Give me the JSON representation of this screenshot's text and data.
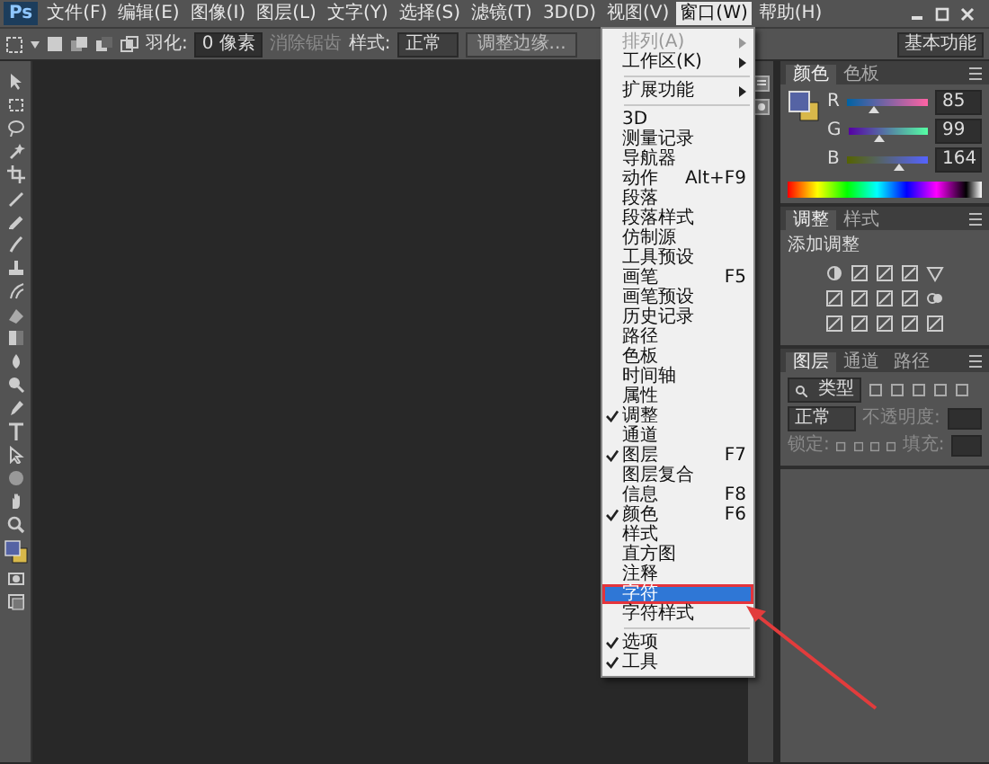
{
  "app_logo": "Ps",
  "menu_bar": [
    {
      "label": "文件(F)",
      "selected": false
    },
    {
      "label": "编辑(E)",
      "selected": false
    },
    {
      "label": "图像(I)",
      "selected": false
    },
    {
      "label": "图层(L)",
      "selected": false
    },
    {
      "label": "文字(Y)",
      "selected": false
    },
    {
      "label": "选择(S)",
      "selected": false
    },
    {
      "label": "滤镜(T)",
      "selected": false
    },
    {
      "label": "3D(D)",
      "selected": false
    },
    {
      "label": "视图(V)",
      "selected": false
    },
    {
      "label": "窗口(W)",
      "selected": true
    },
    {
      "label": "帮助(H)",
      "selected": false
    }
  ],
  "options_bar": {
    "feather_label": "羽化:",
    "feather_value": "0 像素",
    "anti_alias": {
      "label": "消除锯齿",
      "disabled": true
    },
    "style_label": "样式:",
    "style_value": "正常",
    "refine_edge": "调整边缘...",
    "workspace": "基本功能"
  },
  "window_menu": [
    {
      "kind": "item",
      "label": "排列(A)",
      "submenu": true,
      "disabled": true,
      "checked": false,
      "selected": false
    },
    {
      "kind": "item",
      "label": "工作区(K)",
      "submenu": true,
      "disabled": false,
      "checked": false,
      "selected": false
    },
    {
      "kind": "separator"
    },
    {
      "kind": "item",
      "label": "扩展功能",
      "submenu": true,
      "disabled": false,
      "checked": false,
      "selected": false
    },
    {
      "kind": "separator"
    },
    {
      "kind": "item",
      "label": "3D",
      "disabled": false,
      "checked": false,
      "selected": false
    },
    {
      "kind": "item",
      "label": "测量记录",
      "disabled": false,
      "checked": false,
      "selected": false
    },
    {
      "kind": "item",
      "label": "导航器",
      "disabled": false,
      "checked": false,
      "selected": false
    },
    {
      "kind": "item",
      "label": "动作",
      "shortcut": "Alt+F9",
      "disabled": false,
      "checked": false,
      "selected": false
    },
    {
      "kind": "item",
      "label": "段落",
      "disabled": false,
      "checked": false,
      "selected": false
    },
    {
      "kind": "item",
      "label": "段落样式",
      "disabled": false,
      "checked": false,
      "selected": false
    },
    {
      "kind": "item",
      "label": "仿制源",
      "disabled": false,
      "checked": false,
      "selected": false
    },
    {
      "kind": "item",
      "label": "工具预设",
      "disabled": false,
      "checked": false,
      "selected": false
    },
    {
      "kind": "item",
      "label": "画笔",
      "shortcut": "F5",
      "disabled": false,
      "checked": false,
      "selected": false
    },
    {
      "kind": "item",
      "label": "画笔预设",
      "disabled": false,
      "checked": false,
      "selected": false
    },
    {
      "kind": "item",
      "label": "历史记录",
      "disabled": false,
      "checked": false,
      "selected": false
    },
    {
      "kind": "item",
      "label": "路径",
      "disabled": false,
      "checked": false,
      "selected": false
    },
    {
      "kind": "item",
      "label": "色板",
      "disabled": false,
      "checked": false,
      "selected": false
    },
    {
      "kind": "item",
      "label": "时间轴",
      "disabled": false,
      "checked": false,
      "selected": false
    },
    {
      "kind": "item",
      "label": "属性",
      "disabled": false,
      "checked": false,
      "selected": false
    },
    {
      "kind": "item",
      "label": "调整",
      "disabled": false,
      "checked": true,
      "selected": false
    },
    {
      "kind": "item",
      "label": "通道",
      "disabled": false,
      "checked": false,
      "selected": false
    },
    {
      "kind": "item",
      "label": "图层",
      "shortcut": "F7",
      "disabled": false,
      "checked": true,
      "selected": false
    },
    {
      "kind": "item",
      "label": "图层复合",
      "disabled": false,
      "checked": false,
      "selected": false
    },
    {
      "kind": "item",
      "label": "信息",
      "shortcut": "F8",
      "disabled": false,
      "checked": false,
      "selected": false
    },
    {
      "kind": "item",
      "label": "颜色",
      "shortcut": "F6",
      "disabled": false,
      "checked": true,
      "selected": false
    },
    {
      "kind": "item",
      "label": "样式",
      "disabled": false,
      "checked": false,
      "selected": false
    },
    {
      "kind": "item",
      "label": "直方图",
      "disabled": false,
      "checked": false,
      "selected": false
    },
    {
      "kind": "item",
      "label": "注释",
      "disabled": false,
      "checked": false,
      "selected": false
    },
    {
      "kind": "item",
      "label": "字符",
      "disabled": false,
      "checked": false,
      "selected": true
    },
    {
      "kind": "item",
      "label": "字符样式",
      "disabled": false,
      "checked": false,
      "selected": false
    },
    {
      "kind": "separator"
    },
    {
      "kind": "item",
      "label": "选项",
      "disabled": false,
      "checked": true,
      "selected": false
    },
    {
      "kind": "item",
      "label": "工具",
      "disabled": false,
      "checked": true,
      "selected": false
    }
  ],
  "color_panel": {
    "tabs": [
      {
        "label": "颜色",
        "selected": true
      },
      {
        "label": "色板",
        "selected": false
      }
    ],
    "channels": [
      {
        "label": "R",
        "value": "85",
        "level": 0.33
      },
      {
        "label": "G",
        "value": "99",
        "level": 0.39
      },
      {
        "label": "B",
        "value": "164",
        "level": 0.64
      }
    ]
  },
  "adjustments_panel": {
    "tabs": [
      {
        "label": "调整",
        "selected": true
      },
      {
        "label": "样式",
        "selected": false
      }
    ],
    "title": "添加调整"
  },
  "layers_panel": {
    "tabs": [
      {
        "label": "图层",
        "selected": true
      },
      {
        "label": "通道",
        "selected": false
      },
      {
        "label": "路径",
        "selected": false
      }
    ],
    "filter": "类型",
    "blend_mode": "正常",
    "opacity_label": "不透明度:",
    "lock_label": "锁定:",
    "fill_label": "填充:"
  }
}
